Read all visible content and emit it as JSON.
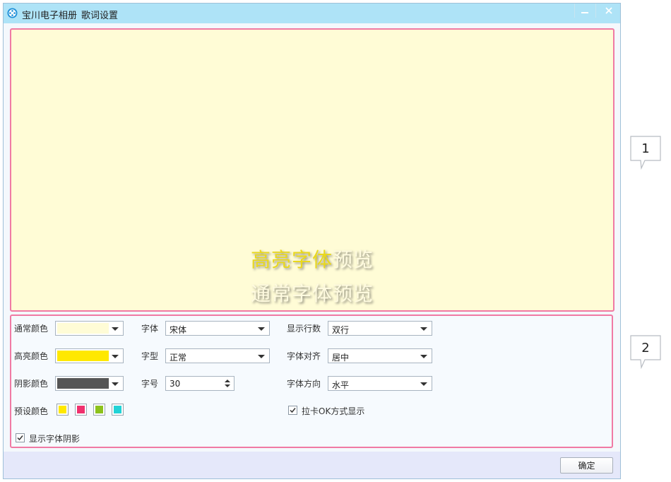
{
  "window": {
    "app_name": "宝川电子相册",
    "dialog_name": "歌词设置"
  },
  "preview": {
    "highlight_part": "高亮字体",
    "highlight_rest": "预览",
    "normal_text": "通常字体预览"
  },
  "settings": {
    "normal_color_label": "通常颜色",
    "normal_color": "#fffcd6",
    "highlight_color_label": "高亮颜色",
    "highlight_color": "#ffe800",
    "shadow_color_label": "阴影颜色",
    "shadow_color": "#555555",
    "preset_color_label": "预设颜色",
    "preset_colors": [
      "#ffe800",
      "#f0306e",
      "#8cc21c",
      "#22d2d6"
    ],
    "font_label": "字体",
    "font_value": "宋体",
    "style_label": "字型",
    "style_value": "正常",
    "size_label": "字号",
    "size_value": "30",
    "lines_label": "显示行数",
    "lines_value": "双行",
    "align_label": "字体对齐",
    "align_value": "居中",
    "direction_label": "字体方向",
    "direction_value": "水平",
    "karaoke_label": "拉卡OK方式显示",
    "karaoke_checked": true,
    "shadow_label": "显示字体阴影",
    "shadow_checked": true
  },
  "footer": {
    "ok_label": "确定"
  },
  "callouts": [
    "1",
    "2"
  ]
}
